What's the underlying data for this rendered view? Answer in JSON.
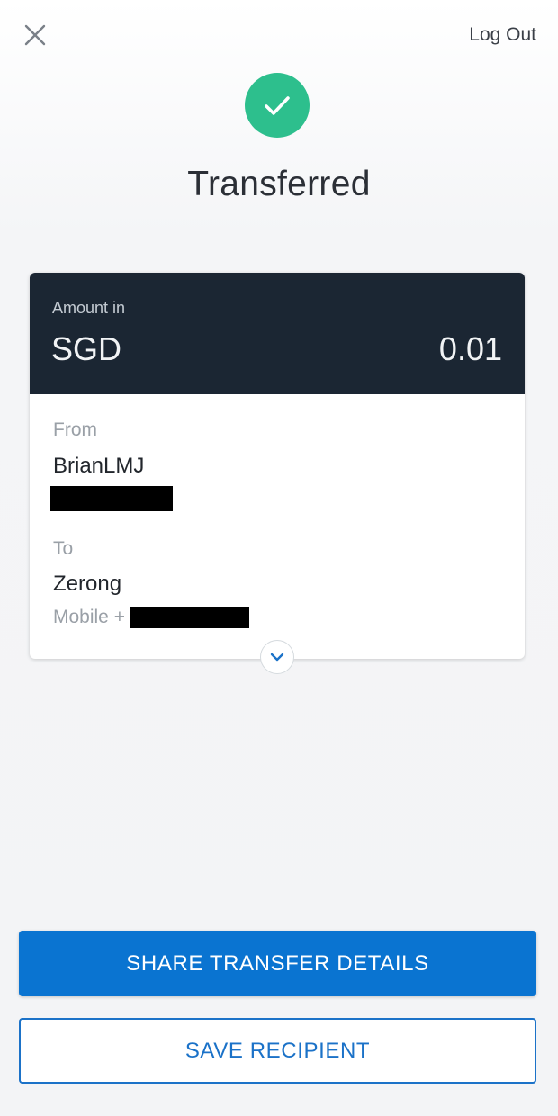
{
  "header": {
    "close_icon": "close-icon",
    "logout_label": "Log Out"
  },
  "status": {
    "icon": "check-icon",
    "title": "Transferred",
    "color": "#2dbf8d"
  },
  "card": {
    "amount_label": "Amount in",
    "currency": "SGD",
    "amount": "0.01",
    "from_label": "From",
    "from_name": "BrianLMJ",
    "to_label": "To",
    "to_name": "Zerong",
    "mobile_prefix": "Mobile +",
    "expand_icon": "chevron-down-icon"
  },
  "actions": {
    "share_label": "SHARE TRANSFER DETAILS",
    "save_label": "SAVE RECIPIENT",
    "primary_color": "#0a74d1"
  }
}
